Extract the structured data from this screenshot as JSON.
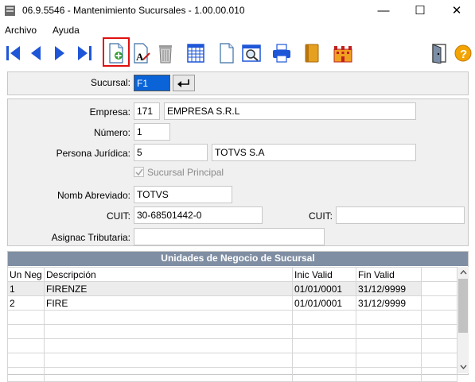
{
  "window": {
    "title": "06.9.5546 - Mantenimiento Sucursales - 1.00.00.010",
    "minimize_glyph": "—",
    "maximize_glyph": "☐",
    "close_glyph": "✕"
  },
  "menu": {
    "items": [
      "Archivo",
      "Ayuda"
    ]
  },
  "toolbar": {
    "buttons": [
      "first-icon",
      "previous-icon",
      "next-icon",
      "last-icon",
      "new-record-icon",
      "edit-text-icon",
      "delete-icon",
      "grid-view-icon",
      "document-icon",
      "print-preview-icon",
      "print-icon",
      "book-icon",
      "building-icon",
      "exit-door-icon",
      "help-icon"
    ]
  },
  "search": {
    "label": "Sucursal:",
    "value": "F1"
  },
  "form": {
    "empresa_label": "Empresa:",
    "empresa_code": "171",
    "empresa_name": "EMPRESA  S.R.L",
    "numero_label": "Número:",
    "numero_value": "1",
    "persona_label": "Persona Jurídica:",
    "persona_code": "5",
    "persona_name": "TOTVS S.A",
    "sucursal_principal_label": "Sucursal Principal",
    "sucursal_principal_checked": true,
    "nomb_label": "Nomb Abreviado:",
    "nomb_value": "TOTVS",
    "cuit_label": "CUIT:",
    "cuit_value": "30-68501442-0",
    "cuit2_label": "CUIT:",
    "cuit2_value": "",
    "asignac_label": "Asignac Tributaria:",
    "asignac_value": ""
  },
  "grid": {
    "title": "Unidades de Negocio de Sucursal",
    "headers": [
      "Un Neg",
      "Descripción",
      "Inic Valid",
      "Fin Valid"
    ],
    "rows": [
      [
        "1",
        "FIRENZE",
        "01/01/0001",
        "31/12/9999"
      ],
      [
        "2",
        "FIRE",
        "01/01/0001",
        "31/12/9999"
      ]
    ]
  },
  "colors": {
    "highlight": "#e01010",
    "toolbar_blue": "#1e56d8",
    "grid_header": "#7f8ea3"
  }
}
